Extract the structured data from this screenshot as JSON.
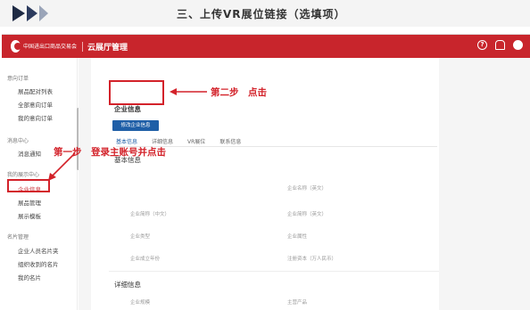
{
  "banner": {
    "title": "三、上传VR展位链接（选填项）"
  },
  "app": {
    "title": "云展厅管理",
    "logo_text": "中国进出口商品交易会",
    "top_icons": [
      "help-icon",
      "bell-icon",
      "user-icon"
    ]
  },
  "sidebar": {
    "groups": [
      {
        "label": "意向订单",
        "items": [
          "展品配对列表",
          "全部意向订单",
          "我的意向订单"
        ]
      },
      {
        "label": "消息中心",
        "items": [
          "消息通知"
        ]
      },
      {
        "label": "我的展示中心",
        "items": [
          "企业信息",
          "展品管理",
          "展示模板"
        ]
      },
      {
        "label": "名片管理",
        "items": [
          "企业人员名片夹",
          "组织收到的名片",
          "我的名片"
        ]
      }
    ]
  },
  "main": {
    "section_title": "企业信息",
    "edit_button": "修改企业信息",
    "tabs": [
      "基本信息",
      "详细信息",
      "VR展位",
      "联系信息"
    ],
    "basic_title": "基本信息",
    "fields": [
      {
        "label": "企业名称（英文）"
      },
      {
        "label": "企业简称（中文）"
      },
      {
        "label": "企业简称（英文）"
      },
      {
        "label": "企业类型"
      },
      {
        "label": "企业属性"
      },
      {
        "label": "企业成立年份"
      },
      {
        "label": "注册资本（万人民币）"
      }
    ],
    "detail_title": "详细信息",
    "detail_fields": [
      {
        "label": "企业规模"
      },
      {
        "label": "主营产品"
      }
    ]
  },
  "annotations": {
    "step2": "第二步　点击",
    "step1": "第一步　登录主账号并点击"
  },
  "colors": {
    "brand_red": "#c8252c",
    "button_blue": "#1f5fa7",
    "annotation_red": "#d3222a"
  }
}
